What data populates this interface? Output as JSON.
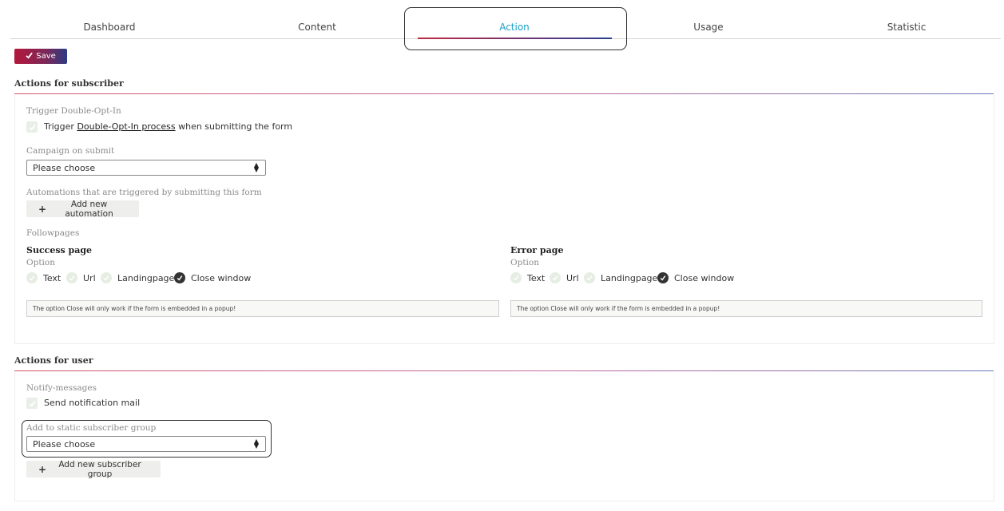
{
  "tabs": [
    {
      "label": "Dashboard"
    },
    {
      "label": "Content"
    },
    {
      "label": "Action"
    },
    {
      "label": "Usage"
    },
    {
      "label": "Statistic"
    }
  ],
  "toolbar": {
    "save_label": "Save"
  },
  "subscriber": {
    "title": "Actions for subscriber",
    "doi_label": "Trigger Double-Opt-In",
    "doi_text_before": "Trigger ",
    "doi_link": "Double-Opt-In process",
    "doi_text_after": " when submitting the form",
    "campaign_label": "Campaign on submit",
    "campaign_value": "Please choose",
    "automations_label": "Automations that are triggered by submitting this form",
    "add_automation": "Add new automation",
    "followpages_label": "Followpages",
    "success": {
      "title": "Success page",
      "option_label": "Option",
      "options": [
        "Text",
        "Url",
        "Landingpage",
        "Close window"
      ],
      "selected": "Close window",
      "notice": "The option Close will only work if the form is embedded in a popup!"
    },
    "error": {
      "title": "Error page",
      "option_label": "Option",
      "options": [
        "Text",
        "Url",
        "Landingpage",
        "Close window"
      ],
      "selected": "Close window",
      "notice": "The option Close will only work if the form is embedded in a popup!"
    }
  },
  "user": {
    "title": "Actions for user",
    "notify_label": "Notify-messages",
    "notify_text": "Send notification mail",
    "group_label": "Add to static subscriber group",
    "group_value": "Please choose",
    "add_group": "Add new subscriber group"
  },
  "colors": {
    "active_tab": "#1aa0c8",
    "brand_start": "#b4173a",
    "brand_end": "#2c3a84"
  }
}
